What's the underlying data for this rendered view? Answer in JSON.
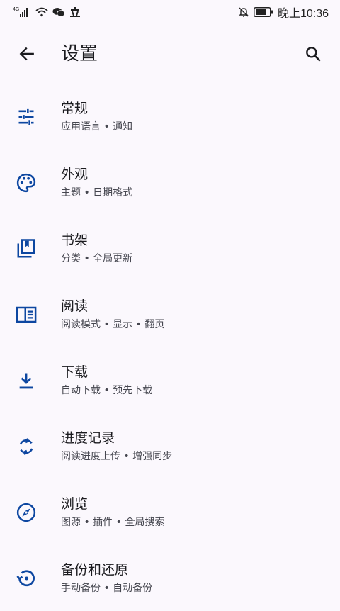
{
  "status_bar": {
    "network": "4G",
    "time": "晚上10:36"
  },
  "app_bar": {
    "title": "设置"
  },
  "settings": [
    {
      "id": "general",
      "label": "常规",
      "subtitle": "应用语言 • 通知",
      "icon": "tune-icon"
    },
    {
      "id": "appearance",
      "label": "外观",
      "subtitle": "主题 • 日期格式",
      "icon": "palette-icon"
    },
    {
      "id": "library",
      "label": "书架",
      "subtitle": "分类 • 全局更新",
      "icon": "bookshelf-icon"
    },
    {
      "id": "reader",
      "label": "阅读",
      "subtitle": "阅读模式 • 显示 • 翻页",
      "icon": "chrome-reader-icon"
    },
    {
      "id": "downloads",
      "label": "下载",
      "subtitle": "自动下载 • 预先下载",
      "icon": "download-icon"
    },
    {
      "id": "tracking",
      "label": "进度记录",
      "subtitle": "阅读进度上传 • 增强同步",
      "icon": "sync-icon"
    },
    {
      "id": "browse",
      "label": "浏览",
      "subtitle": "图源 • 插件 • 全局搜索",
      "icon": "compass-icon"
    },
    {
      "id": "backup",
      "label": "备份和还原",
      "subtitle": "手动备份 • 自动备份",
      "icon": "restore-icon"
    }
  ],
  "colors": {
    "accent": "#0d47a1",
    "background": "#fbf8fd",
    "text": "#1b1b1f",
    "subtext": "#45464f"
  }
}
